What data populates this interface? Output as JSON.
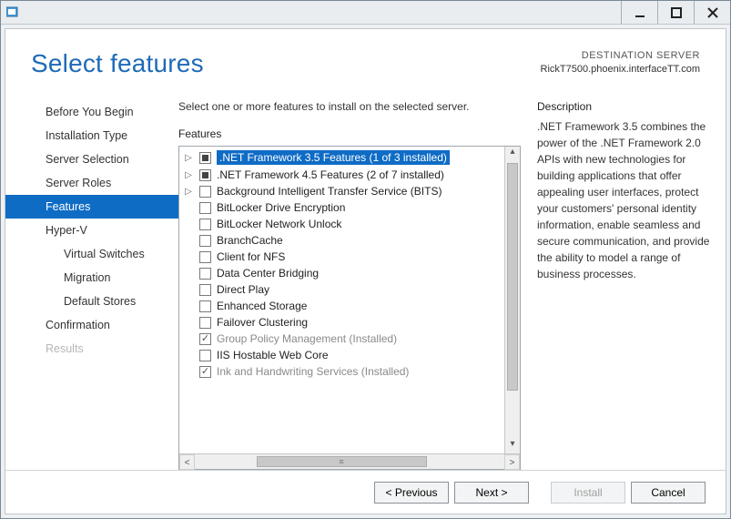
{
  "header": {
    "title": "Select features",
    "dest_label": "DESTINATION SERVER",
    "dest_server": "RickT7500.phoenix.interfaceTT.com"
  },
  "sidebar": {
    "items": [
      {
        "label": "Before You Begin",
        "active": false,
        "disabled": false,
        "indent": false
      },
      {
        "label": "Installation Type",
        "active": false,
        "disabled": false,
        "indent": false
      },
      {
        "label": "Server Selection",
        "active": false,
        "disabled": false,
        "indent": false
      },
      {
        "label": "Server Roles",
        "active": false,
        "disabled": false,
        "indent": false
      },
      {
        "label": "Features",
        "active": true,
        "disabled": false,
        "indent": false
      },
      {
        "label": "Hyper-V",
        "active": false,
        "disabled": false,
        "indent": false
      },
      {
        "label": "Virtual Switches",
        "active": false,
        "disabled": false,
        "indent": true
      },
      {
        "label": "Migration",
        "active": false,
        "disabled": false,
        "indent": true
      },
      {
        "label": "Default Stores",
        "active": false,
        "disabled": false,
        "indent": true
      },
      {
        "label": "Confirmation",
        "active": false,
        "disabled": false,
        "indent": false
      },
      {
        "label": "Results",
        "active": false,
        "disabled": true,
        "indent": false
      }
    ]
  },
  "main": {
    "instruction": "Select one or more features to install on the selected server.",
    "features_label": "Features",
    "description_label": "Description",
    "description_text": ".NET Framework 3.5 combines the power of the .NET Framework 2.0 APIs with new technologies for building applications that offer appealing user interfaces, protect your customers' personal identity information, enable seamless and secure communication, and provide the ability to model a range of business processes.",
    "features": [
      {
        "label": ".NET Framework 3.5 Features (1 of 3 installed)",
        "check": "partial",
        "expandable": true,
        "selected": true,
        "disabled": false
      },
      {
        "label": ".NET Framework 4.5 Features (2 of 7 installed)",
        "check": "partial",
        "expandable": true,
        "selected": false,
        "disabled": false
      },
      {
        "label": "Background Intelligent Transfer Service (BITS)",
        "check": "none",
        "expandable": true,
        "selected": false,
        "disabled": false
      },
      {
        "label": "BitLocker Drive Encryption",
        "check": "none",
        "expandable": false,
        "selected": false,
        "disabled": false
      },
      {
        "label": "BitLocker Network Unlock",
        "check": "none",
        "expandable": false,
        "selected": false,
        "disabled": false
      },
      {
        "label": "BranchCache",
        "check": "none",
        "expandable": false,
        "selected": false,
        "disabled": false
      },
      {
        "label": "Client for NFS",
        "check": "none",
        "expandable": false,
        "selected": false,
        "disabled": false
      },
      {
        "label": "Data Center Bridging",
        "check": "none",
        "expandable": false,
        "selected": false,
        "disabled": false
      },
      {
        "label": "Direct Play",
        "check": "none",
        "expandable": false,
        "selected": false,
        "disabled": false
      },
      {
        "label": "Enhanced Storage",
        "check": "none",
        "expandable": false,
        "selected": false,
        "disabled": false
      },
      {
        "label": "Failover Clustering",
        "check": "none",
        "expandable": false,
        "selected": false,
        "disabled": false
      },
      {
        "label": "Group Policy Management (Installed)",
        "check": "checked",
        "expandable": false,
        "selected": false,
        "disabled": true
      },
      {
        "label": "IIS Hostable Web Core",
        "check": "none",
        "expandable": false,
        "selected": false,
        "disabled": false
      },
      {
        "label": "Ink and Handwriting Services (Installed)",
        "check": "checked",
        "expandable": false,
        "selected": false,
        "disabled": true
      }
    ]
  },
  "footer": {
    "previous": "< Previous",
    "next": "Next >",
    "install": "Install",
    "cancel": "Cancel"
  }
}
